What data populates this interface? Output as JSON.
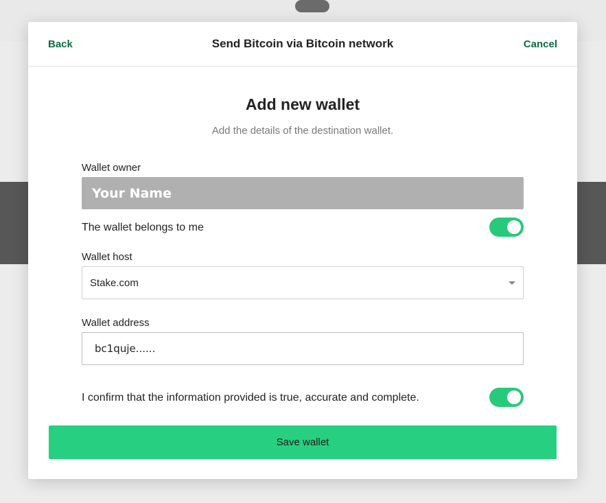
{
  "header": {
    "back_label": "Back",
    "title": "Send Bitcoin via Bitcoin network",
    "cancel_label": "Cancel"
  },
  "form": {
    "heading": "Add new wallet",
    "subheading": "Add the details of the destination wallet.",
    "owner": {
      "label": "Wallet owner",
      "placeholder": "Your Name"
    },
    "belongs_to_me": {
      "label": "The wallet belongs to me",
      "checked": true
    },
    "host": {
      "label": "Wallet host",
      "selected": "Stake.com"
    },
    "address": {
      "label": "Wallet address",
      "value": "bc1quje......"
    },
    "confirm": {
      "label": "I confirm that the information provided is true, accurate and complete.",
      "checked": true
    },
    "save_label": "Save wallet"
  },
  "colors": {
    "accent": "#27d081",
    "toggle_on": "#27c97b",
    "link": "#0d6b45",
    "owner_fill": "#b0b0b0"
  }
}
